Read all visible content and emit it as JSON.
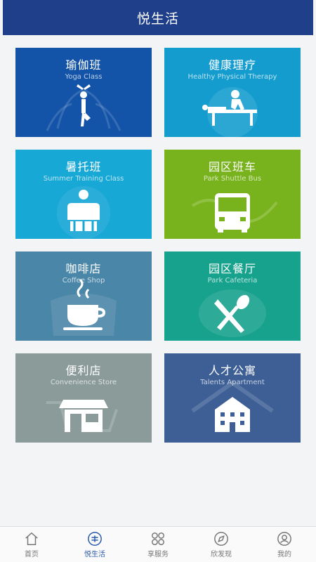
{
  "header": {
    "title": "悦生活"
  },
  "tiles": [
    {
      "title": "瑜伽班",
      "subtitle": "Yoga Class",
      "icon": "yoga-icon"
    },
    {
      "title": "健康理疗",
      "subtitle": "Healthy Physical Therapy",
      "icon": "massage-icon"
    },
    {
      "title": "暑托班",
      "subtitle": "Summer Training Class",
      "icon": "children-icon"
    },
    {
      "title": "园区班车",
      "subtitle": "Park Shuttle Bus",
      "icon": "bus-icon"
    },
    {
      "title": "咖啡店",
      "subtitle": "Coffee Shop",
      "icon": "coffee-cup-icon"
    },
    {
      "title": "园区餐厅",
      "subtitle": "Park Cafeteria",
      "icon": "knife-spoon-icon"
    },
    {
      "title": "便利店",
      "subtitle": "Convenience Store",
      "icon": "storefront-icon"
    },
    {
      "title": "人才公寓",
      "subtitle": "Talents Apartment",
      "icon": "apartment-building-icon"
    }
  ],
  "tabbar": [
    {
      "label": "首页",
      "icon": "home-icon",
      "active": false
    },
    {
      "label": "悦生活",
      "icon": "life-icon",
      "active": true
    },
    {
      "label": "享服务",
      "icon": "grid-icon",
      "active": false
    },
    {
      "label": "欣发现",
      "icon": "compass-icon",
      "active": false
    },
    {
      "label": "我的",
      "icon": "user-icon",
      "active": false
    }
  ],
  "colors": {
    "header": "#1f3f8a",
    "yoga": "#1454a8",
    "therapy": "#159ccf",
    "summer": "#18a8d6",
    "bus": "#78b21c",
    "coffee": "#4a86a8",
    "cafeteria": "#17a28d",
    "store": "#8a9b9a",
    "apartment": "#3d5f96",
    "tab_active": "#2a5aa8"
  }
}
